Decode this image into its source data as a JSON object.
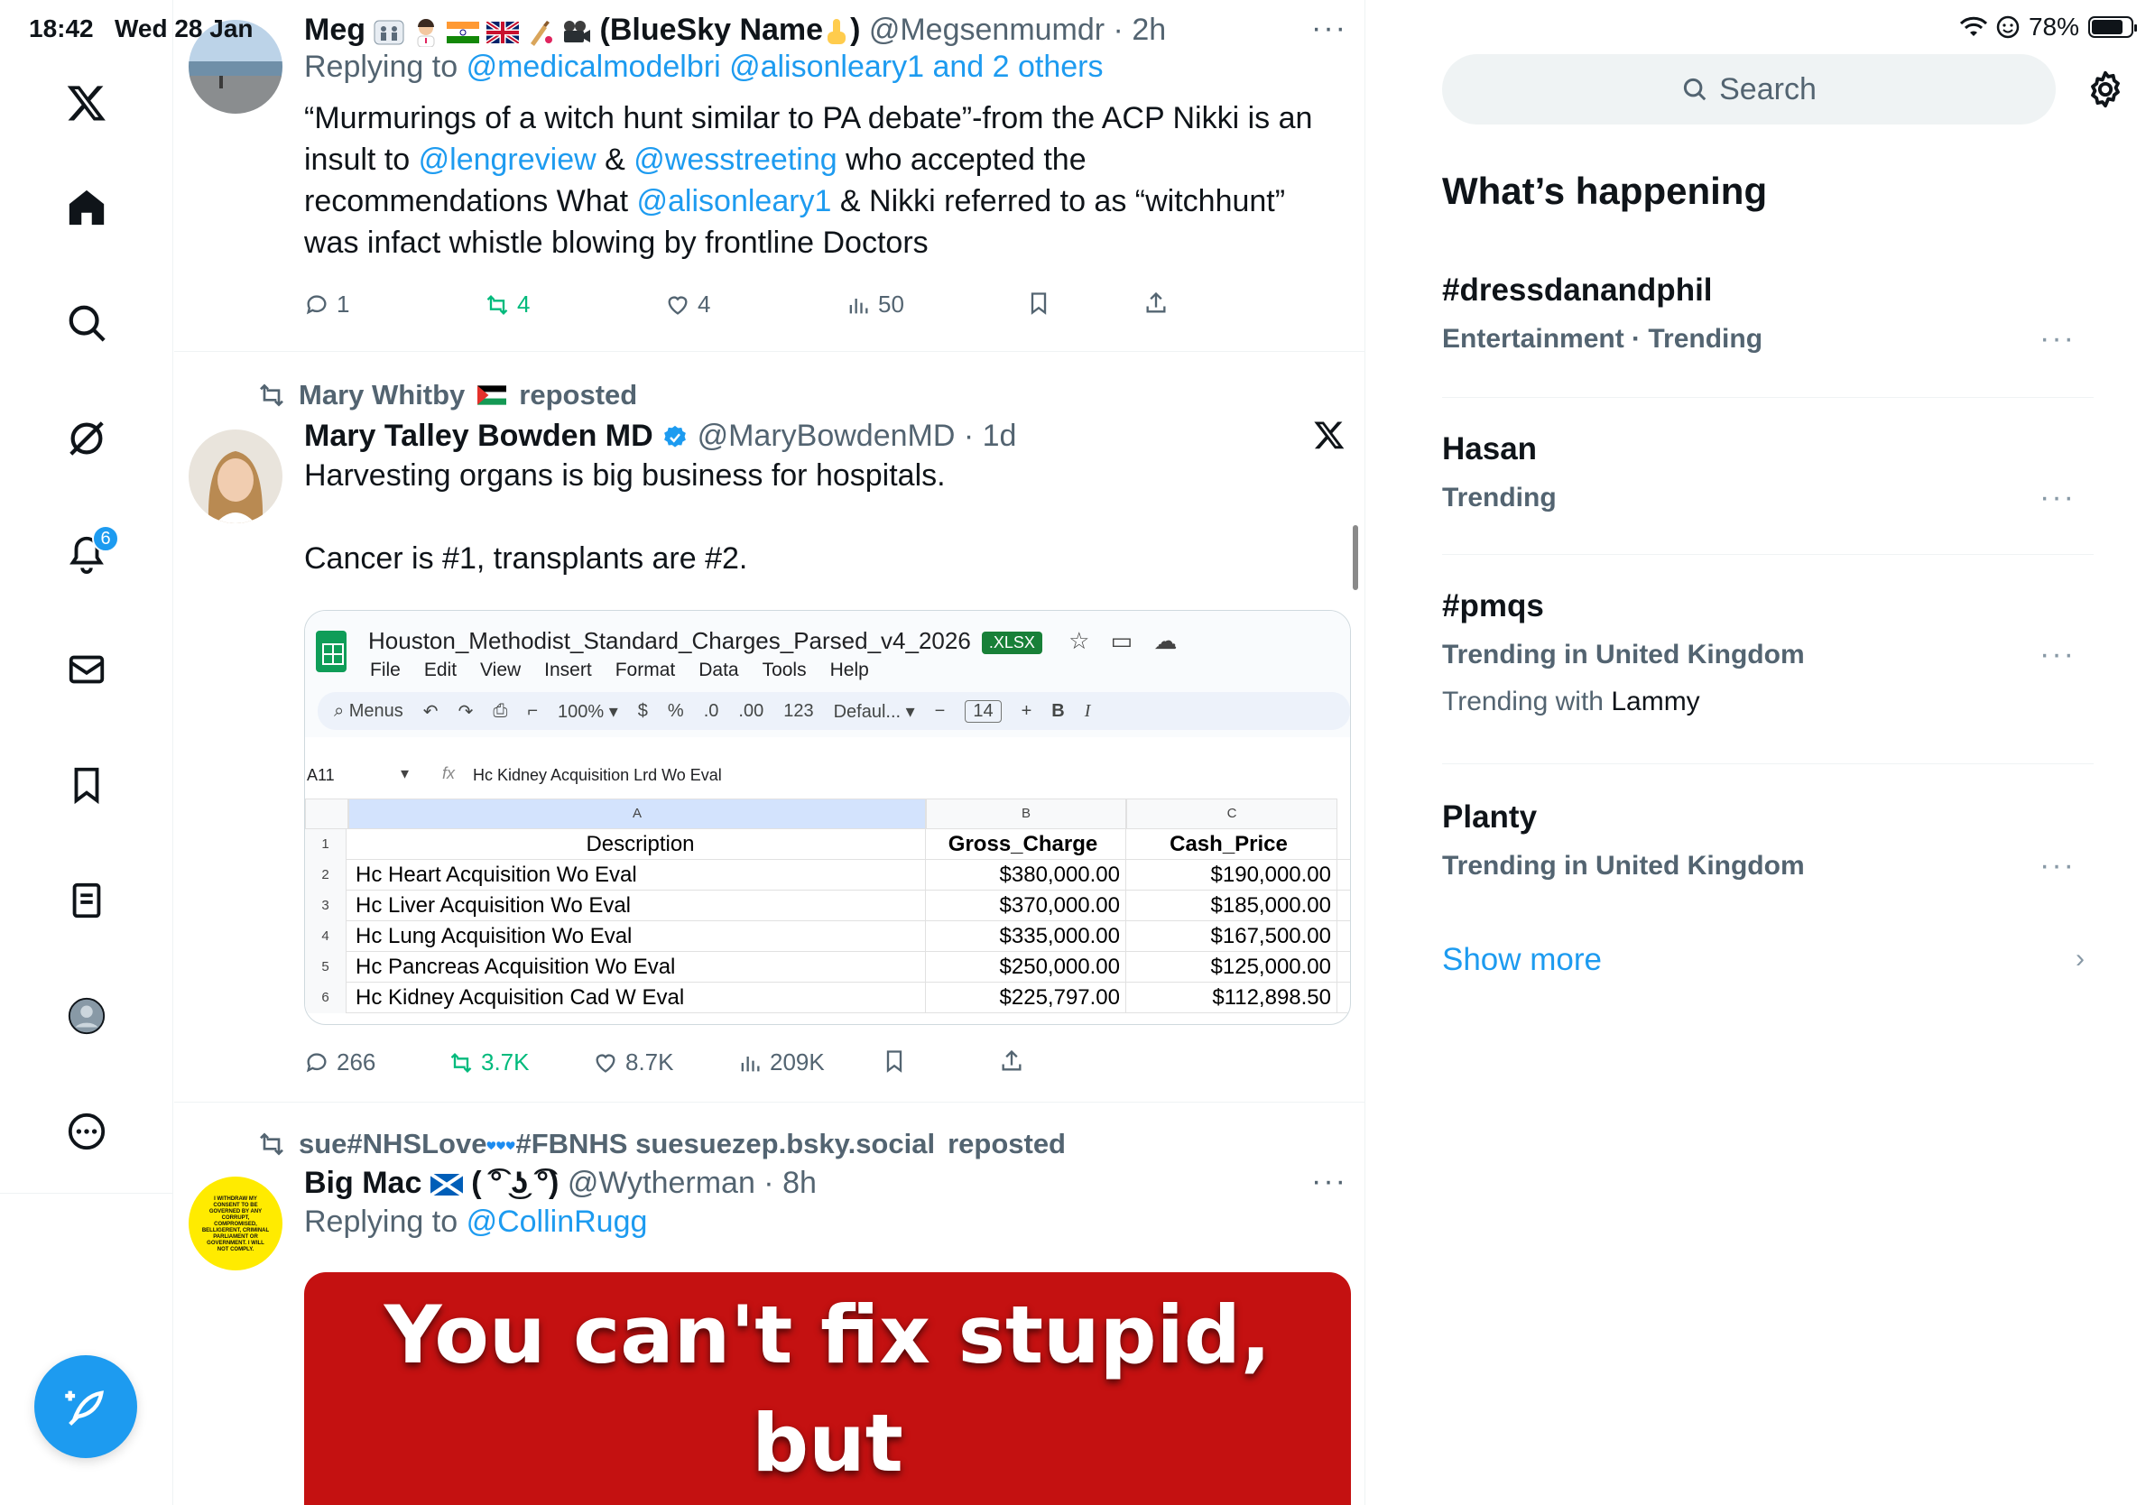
{
  "status": {
    "time": "18:42",
    "date": "Wed 28 Jan",
    "battery": "78%"
  },
  "nav": {
    "notifications_badge": "6"
  },
  "timeline": {
    "tweet1": {
      "name": "Meg",
      "name_suffix": "(BlueSky Name",
      "name_close": ")",
      "handle": "@Megsenmumdr",
      "time": "2h",
      "replying_prefix": "Replying to",
      "replying_to": "@medicalmodelbri @alisonleary1 and 2 others",
      "text_1": "“Murmurings of a witch hunt similar to PA debate”-from the ACP Nikki is an insult to ",
      "mention_1": "@lengreview",
      "text_2": " & ",
      "mention_2": "@wesstreeting",
      "text_3": " who accepted the recommendations What ",
      "mention_3": "@alisonleary1",
      "text_4": " & Nikki referred to as “witchhunt” was infact whistle blowing by frontline Doctors",
      "replies": "1",
      "reposts": "4",
      "likes": "4",
      "views": "50"
    },
    "tweet2": {
      "reposted_by": "Mary Whitby",
      "reposted_label": "reposted",
      "name": "Mary Talley Bowden MD",
      "handle": "@MaryBowdenMD",
      "time": "1d",
      "text_1": "Harvesting organs is big business for hospitals.",
      "text_2": "Cancer is #1, transplants are #2.",
      "replies": "266",
      "reposts": "3.7K",
      "likes": "8.7K",
      "views": "209K",
      "sheet": {
        "title": "Houston_Methodist_Standard_Charges_Parsed_v4_2026",
        "badge": ".XLSX",
        "menu": [
          "File",
          "Edit",
          "View",
          "Insert",
          "Format",
          "Data",
          "Tools",
          "Help"
        ],
        "toolbar": {
          "menus": "Menus",
          "zoom": "100%",
          "currency": "$",
          "percent": "%",
          "dec_minus": ".0",
          "dec_plus": ".00",
          "number": "123",
          "font": "Defaul...",
          "font_size": "14",
          "bold": "B",
          "italic": "I"
        },
        "cell_ref": "A11",
        "formula": "Hc Kidney Acquisition Lrd Wo Eval",
        "columns": [
          "A",
          "B",
          "C"
        ],
        "header": {
          "row": "1",
          "description": "Description",
          "gross": "Gross_Charge",
          "cash": "Cash_Price"
        },
        "rows": [
          {
            "row": "2",
            "description": "Hc Heart Acquisition Wo Eval",
            "gross": "$380,000.00",
            "cash": "$190,000.00"
          },
          {
            "row": "3",
            "description": "Hc Liver Acquisition Wo Eval",
            "gross": "$370,000.00",
            "cash": "$185,000.00"
          },
          {
            "row": "4",
            "description": "Hc Lung Acquisition Wo Eval",
            "gross": "$335,000.00",
            "cash": "$167,500.00"
          },
          {
            "row": "5",
            "description": "Hc Pancreas Acquisition Wo Eval",
            "gross": "$250,000.00",
            "cash": "$125,000.00"
          },
          {
            "row": "6",
            "description": "Hc Kidney Acquisition Cad W Eval",
            "gross": "$225,797.00",
            "cash": "$112,898.50"
          }
        ]
      }
    },
    "tweet3": {
      "reposted_by": "sue#NHSLove",
      "reposted_suffix": "#FBNHS suesuezep.bsky.social",
      "reposted_label": "reposted",
      "name": "Big Mac",
      "name_face": "( ͡° ͜ʖ ͡°)",
      "handle": "@Wytherman",
      "time": "8h",
      "replying_prefix": "Replying to",
      "replying_to": "@CollinRugg",
      "avatar_text": "I WITHDRAW MY CONSENT TO BE GOVERNED BY ANY CORRUPT, COMPROMISED, BELLIGERENT, CRIMINAL PARLIAMENT OR GOVERNMENT. I WILL NOT COMPLY.",
      "meme_line_1": "You can't fix stupid,",
      "meme_line_2": "but"
    }
  },
  "sidebar": {
    "search_placeholder": "Search",
    "section_title": "What’s happening",
    "trends": [
      {
        "name": "#dressdanandphil",
        "meta": "Entertainment · Trending"
      },
      {
        "name": "Hasan",
        "meta": "Trending"
      },
      {
        "name": "#pmqs",
        "meta": "Trending in United Kingdom",
        "with_prefix": "Trending with",
        "with": "Lammy"
      },
      {
        "name": "Planty",
        "meta": "Trending in United Kingdom"
      }
    ],
    "show_more": "Show more"
  },
  "colors": {
    "accent": "#1d9bf0",
    "repost_green": "#00ba7c",
    "text_secondary": "#536471",
    "meme_red": "#c41111"
  }
}
